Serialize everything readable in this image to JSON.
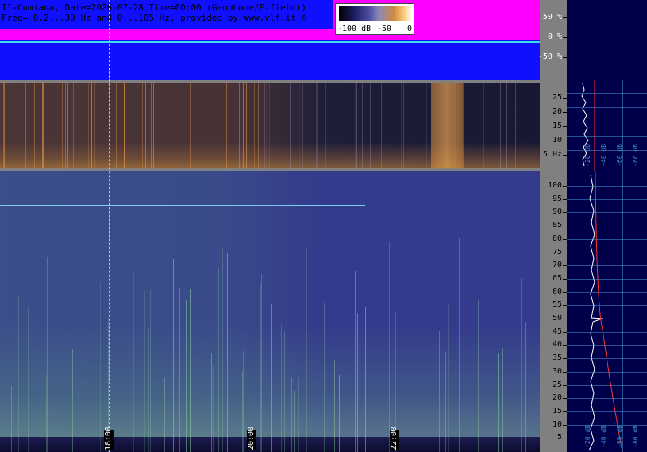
{
  "header": {
    "line1": "I1-Cumiana, Date=2026-07-28 Time=00:00 (Geophone/E-field))",
    "line2": "Freq= 0.2...30 Hz and 0...105 Hz, provided by www.vlf.it ©"
  },
  "color_scale": {
    "labels": [
      "-100 dB",
      "-50",
      "0"
    ]
  },
  "amplitude_axis": [
    "50 %",
    "0 %",
    "-50 %"
  ],
  "low_freq_axis": [
    "25",
    "20",
    "15",
    "10",
    "5 Hz"
  ],
  "high_freq_axis": [
    "100",
    "95",
    "90",
    "85",
    "80",
    "75",
    "70",
    "65",
    "60",
    "55",
    "50",
    "45",
    "40",
    "35",
    "30",
    "25",
    "20",
    "15",
    "10",
    "5"
  ],
  "time_labels": [
    "18:00",
    "20:00",
    "22:00"
  ],
  "profile_labels": [
    "-20 dB",
    "-40 dB",
    "-60 dB",
    "-80 dB"
  ],
  "colors": {
    "amplitude_bg": "#1010ff",
    "amplitude_band": "#ff00ff",
    "trace": "#3de0e8",
    "spectrogram_bg": "#343a8c",
    "marker_line": "#ff2020",
    "profile_bg": "#00004a"
  }
}
